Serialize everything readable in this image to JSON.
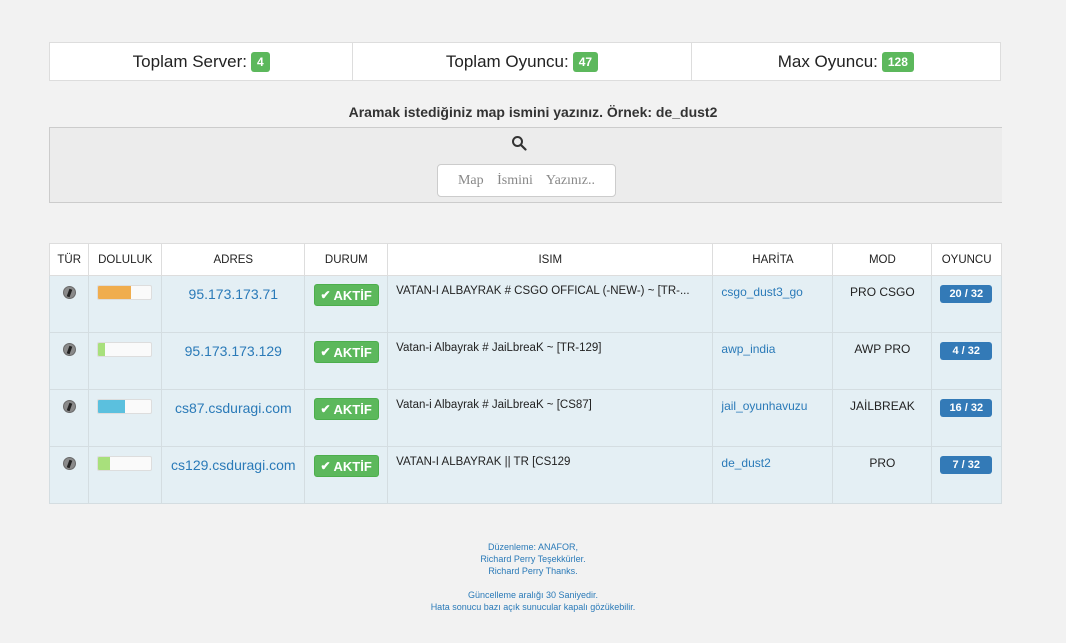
{
  "stats": [
    {
      "label": "Toplam Server:",
      "value": "4"
    },
    {
      "label": "Toplam Oyuncu:",
      "value": "47"
    },
    {
      "label": "Max Oyuncu:",
      "value": "128"
    }
  ],
  "search": {
    "title": "Aramak istediğiniz map ismini yazınız. Örnek: de_dust2",
    "placeholder": "Map İsmini Yazınız.."
  },
  "table": {
    "headers": [
      "TÜR",
      "DOLULUK",
      "ADRES",
      "DURUM",
      "ISIM",
      "HARİTA",
      "MOD",
      "OYUNCU"
    ],
    "rows": [
      {
        "fill_percent": 62,
        "fill_color": "#f0ad4e",
        "address": "95.173.173.71",
        "status": "AKTİF",
        "name": "VATAN-I ALBAYRAK # CSGO OFFICAL (-NEW-) ~ [TR-...",
        "map": "csgo_dust3_go",
        "mod": "PRO CSGO",
        "players": "20 / 32"
      },
      {
        "fill_percent": 12,
        "fill_color": "#a8e07c",
        "address": "95.173.173.129",
        "status": "AKTİF",
        "name": "Vatan-i Albayrak # JaiLbreaK ~ [TR-129]",
        "map": "awp_india",
        "mod": "AWP PRO",
        "players": "4 / 32"
      },
      {
        "fill_percent": 50,
        "fill_color": "#5bc0de",
        "address": "cs87.csduragi.com",
        "status": "AKTİF",
        "name": "Vatan-i Albayrak # JaiLbreaK ~ [CS87]",
        "map": "jail_oyunhavuzu",
        "mod": "JAİLBREAK",
        "players": "16 / 32"
      },
      {
        "fill_percent": 22,
        "fill_color": "#a8e07c",
        "address": "cs129.csduragi.com",
        "status": "AKTİF",
        "name": "VATAN-I ALBAYRAK || TR [CS129",
        "map": "de_dust2",
        "mod": "PRO",
        "players": "7 / 32"
      }
    ]
  },
  "footer": {
    "line1": "Düzenleme: ANAFOR,",
    "line2": "Richard Perry Teşekkürler.",
    "line3": "Richard Perry Thanks.",
    "line4": "Güncelleme aralığı 30 Saniyedir.",
    "line5": "Hata sonucu bazı açık sunucular kapalı gözükebilir."
  },
  "colors": {
    "accent_green": "#5cb85c",
    "accent_blue": "#337ab7",
    "link": "#2a7ab8",
    "row_bg": "#e4eff4"
  },
  "icons": {
    "search": "search-icon",
    "type": "game-type-icon",
    "status": "check-icon"
  }
}
